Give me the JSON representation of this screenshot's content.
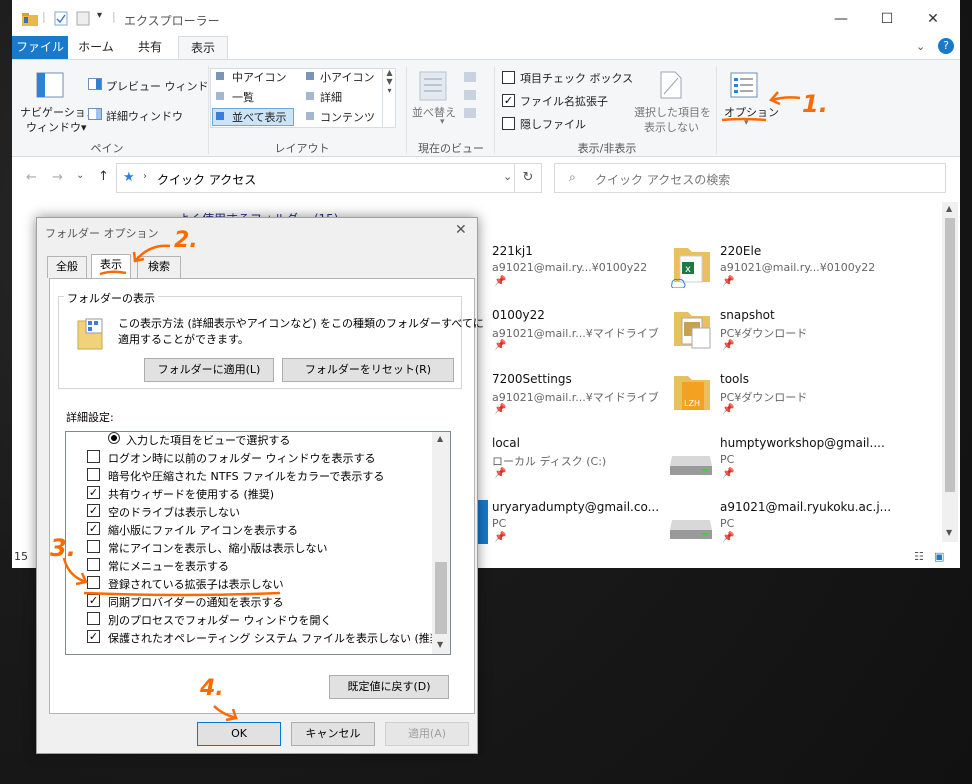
{
  "window": {
    "title": "エクスプローラー",
    "minimize": "—",
    "maximize": "☐",
    "close": "✕",
    "help": "?"
  },
  "ribbon_tabs": [
    "ファイル",
    "ホーム",
    "共有",
    "表示"
  ],
  "ribbon": {
    "panes": {
      "nav_pane": "ナビゲーション\nウィンドウ▾",
      "nav_line1": "ナビゲーション",
      "nav_line2": "ウィンドウ▾",
      "preview": "プレビュー ウィンドウ",
      "details": "詳細ウィンドウ",
      "group": "ペイン"
    },
    "layout": {
      "items": [
        "中アイコン",
        "小アイコン",
        "一覧",
        "詳細",
        "並べて表示",
        "コンテンツ"
      ],
      "group": "レイアウト"
    },
    "current_view": {
      "sort": "並べ替え",
      "group": "現在のビュー"
    },
    "show_hide": {
      "item_checkbox": "項目チェック ボックス",
      "extensions": "ファイル名拡張子",
      "hidden": "隠しファイル",
      "hide_selected_1": "選択した項目を",
      "hide_selected_2": "表示しない",
      "group": "表示/非表示"
    },
    "options": "オプション"
  },
  "address": {
    "path": "クイック アクセス",
    "search_placeholder": "クイック アクセスの検索"
  },
  "content": {
    "section": "よく使用するフォルダー (15)",
    "status": "15",
    "items": [
      {
        "name": "221kj1",
        "sub": "a91021@mail.ry...¥0100y22"
      },
      {
        "name": "220Ele",
        "sub": "a91021@mail.ry...¥0100y22"
      },
      {
        "name": "0100y22",
        "sub": "a91021@mail.r...¥マイドライブ"
      },
      {
        "name": "snapshot",
        "sub": "PC¥ダウンロード"
      },
      {
        "name": "7200Settings",
        "sub": "a91021@mail.r...¥マイドライブ"
      },
      {
        "name": "tools",
        "sub": "PC¥ダウンロード"
      },
      {
        "name": "local",
        "sub": "ローカル ディスク (C:)"
      },
      {
        "name": "humptyworkshop@gmail....",
        "sub": "PC"
      },
      {
        "name": "uryaryadumpty@gmail.co...",
        "sub": "PC"
      },
      {
        "name": "a91021@mail.ryukoku.ac.j...",
        "sub": "PC"
      }
    ]
  },
  "dialog": {
    "title": "フォルダー オプション",
    "tabs": [
      "全般",
      "表示",
      "検索"
    ],
    "folder_view_legend": "フォルダーの表示",
    "folder_view_desc1": "この表示方法 (詳細表示やアイコンなど) をこの種類のフォルダーすべてに",
    "folder_view_desc2": "適用することができます。",
    "apply_to_folders": "フォルダーに適用(L)",
    "reset_folders": "フォルダーをリセット(R)",
    "advanced_label": "詳細設定:",
    "settings": [
      {
        "label": "入力した項目をビューで選択する",
        "type": "radio",
        "checked": true
      },
      {
        "label": "ログオン時に以前のフォルダー ウィンドウを表示する",
        "type": "checkbox",
        "checked": false
      },
      {
        "label": "暗号化や圧縮された NTFS ファイルをカラーで表示する",
        "type": "checkbox",
        "checked": false
      },
      {
        "label": "共有ウィザードを使用する (推奨)",
        "type": "checkbox",
        "checked": true
      },
      {
        "label": "空のドライブは表示しない",
        "type": "checkbox",
        "checked": true
      },
      {
        "label": "縮小版にファイル アイコンを表示する",
        "type": "checkbox",
        "checked": true
      },
      {
        "label": "常にアイコンを表示し、縮小版は表示しない",
        "type": "checkbox",
        "checked": false
      },
      {
        "label": "常にメニューを表示する",
        "type": "checkbox",
        "checked": false
      },
      {
        "label": "登録されている拡張子は表示しない",
        "type": "checkbox",
        "checked": false
      },
      {
        "label": "同期プロバイダーの通知を表示する",
        "type": "checkbox",
        "checked": true
      },
      {
        "label": "別のプロセスでフォルダー ウィンドウを開く",
        "type": "checkbox",
        "checked": false
      },
      {
        "label": "保護されたオペレーティング システム ファイルを表示しない (推奨)",
        "type": "checkbox",
        "checked": true
      }
    ],
    "restore_defaults": "既定値に戻す(D)",
    "ok": "OK",
    "cancel": "キャンセル",
    "apply": "適用(A)"
  },
  "annotations": [
    "1.",
    "2.",
    "3.",
    "4."
  ],
  "colors": {
    "accent": "#1979ca",
    "annotation": "#ff6a00",
    "dialog_bg": "#f0f0f0"
  }
}
